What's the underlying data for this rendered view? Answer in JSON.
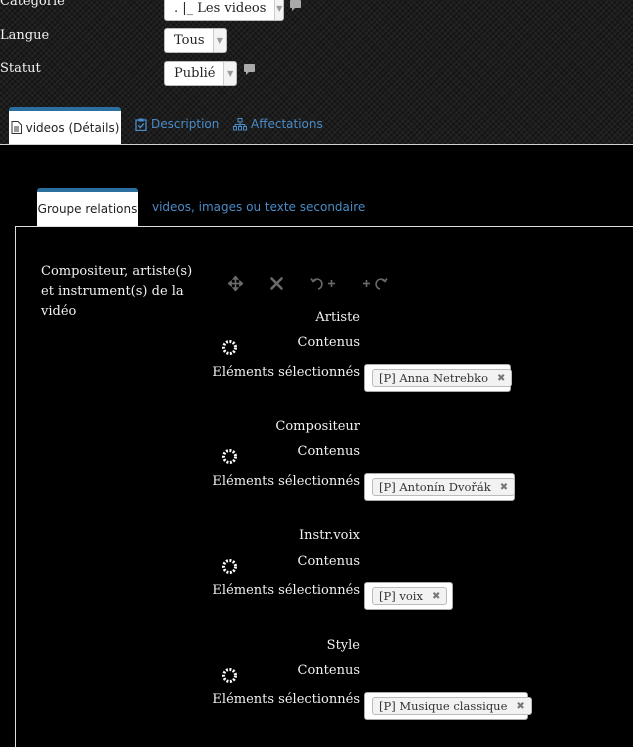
{
  "filters": {
    "categorie_label": "Catégorie",
    "categorie_value": ". |_ Les videos",
    "langue_label": "Langue",
    "langue_value": "Tous",
    "statut_label": "Statut",
    "statut_value": "Publié"
  },
  "tabs": [
    {
      "label": "videos (Détails)",
      "icon": "document-icon"
    },
    {
      "label": "Description",
      "icon": "clipboard-check-icon"
    },
    {
      "label": "Affectations",
      "icon": "sitemap-icon"
    }
  ],
  "subtabs": [
    {
      "label": "Groupe relations"
    },
    {
      "label": "videos, images ou texte secondaire"
    }
  ],
  "section_description": "Compositeur, artiste(s) et instrument(s) de la vidéo",
  "toolbar_icons": [
    "move-icon",
    "remove-icon",
    "undo-add-icon",
    "redo-add-icon"
  ],
  "groups": [
    {
      "title": "Artiste",
      "contenus_label": "Contenus",
      "selected_label": "Eléments sélectionnés",
      "chip": "[P] Anna Netrebko"
    },
    {
      "title": "Compositeur",
      "contenus_label": "Contenus",
      "selected_label": "Eléments sélectionnés",
      "chip": "[P] Antonín Dvořák"
    },
    {
      "title": "Instr.voix",
      "contenus_label": "Contenus",
      "selected_label": "Eléments sélectionnés",
      "chip": "[P] voix"
    },
    {
      "title": "Style",
      "contenus_label": "Contenus",
      "selected_label": "Eléments sélectionnés",
      "chip": "[P] Musique classique"
    }
  ],
  "chip_remove_glyph": "✖"
}
